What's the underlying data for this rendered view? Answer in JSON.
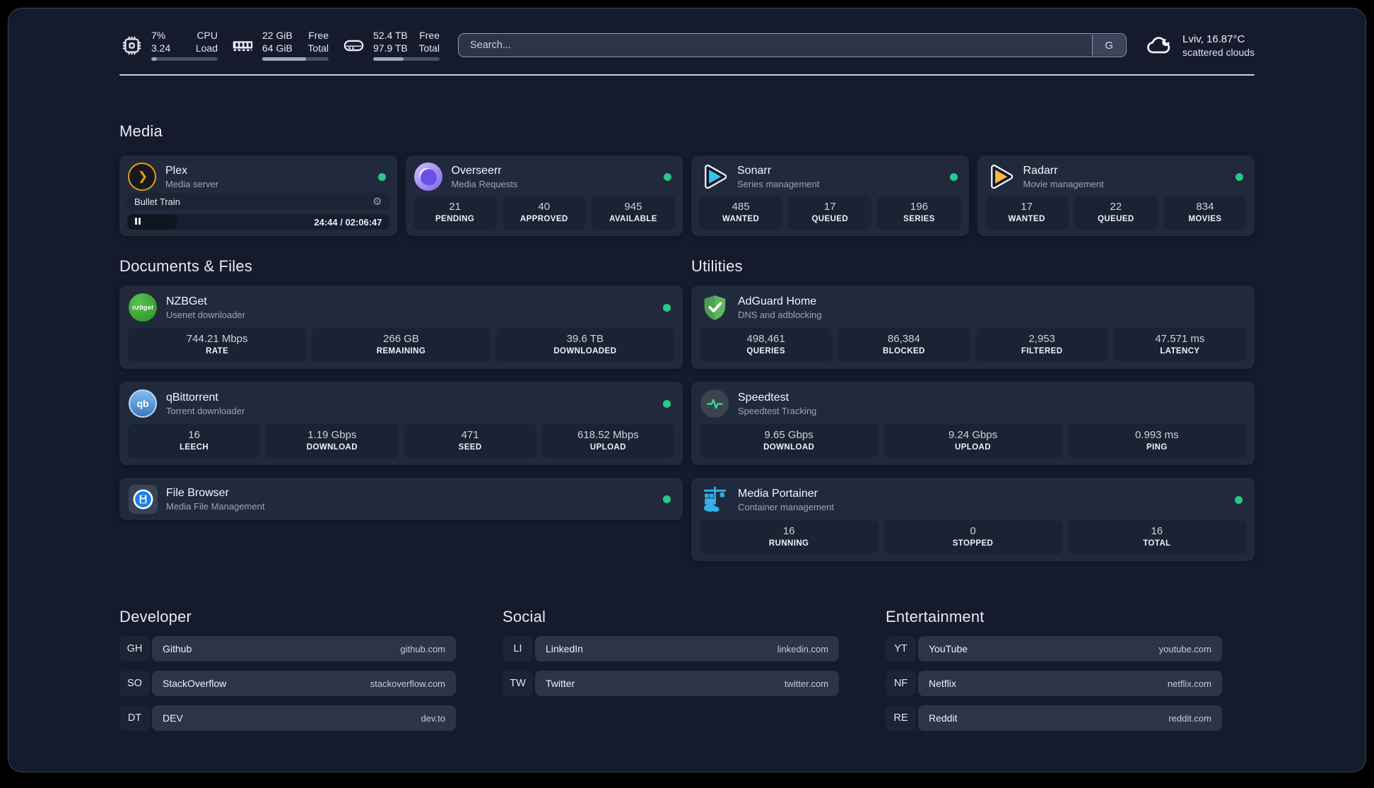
{
  "system_stats": [
    {
      "id": "cpu",
      "icon": "cpu-icon",
      "col1": [
        "7%",
        "3.24"
      ],
      "col2": [
        "CPU",
        "Load"
      ],
      "progress": 8
    },
    {
      "id": "memory",
      "icon": "ram-icon",
      "col1": [
        "22 GiB",
        "64 GiB"
      ],
      "col2": [
        "Free",
        "Total"
      ],
      "progress": 66
    },
    {
      "id": "storage",
      "icon": "disk-icon",
      "col1": [
        "52.4 TB",
        "97.9 TB"
      ],
      "col2": [
        "Free",
        "Total"
      ],
      "progress": 46
    }
  ],
  "search": {
    "placeholder": "Search...",
    "engine": "G"
  },
  "weather": {
    "icon": "cloud-icon",
    "line1": "Lviv, 16.87°C",
    "line2": "scattered clouds"
  },
  "colors": {
    "status_online": "#28c78b",
    "plex_accent": "#e5a00d"
  },
  "sections": [
    {
      "id": "media",
      "title": "Media",
      "cards": [
        {
          "id": "plex",
          "icon": "plex-icon",
          "name": "Plex",
          "subtitle": "Media server",
          "online": true,
          "now_playing": {
            "title": "Bullet Train",
            "time": "24:44 / 02:06:47",
            "progress_pct": 19,
            "state": "paused"
          },
          "stats": []
        },
        {
          "id": "overseerr",
          "icon": "overseerr-icon",
          "name": "Overseerr",
          "subtitle": "Media Requests",
          "online": true,
          "stats": [
            {
              "value": "21",
              "label": "PENDING"
            },
            {
              "value": "40",
              "label": "APPROVED"
            },
            {
              "value": "945",
              "label": "AVAILABLE"
            }
          ]
        },
        {
          "id": "sonarr",
          "icon": "sonarr-icon",
          "name": "Sonarr",
          "subtitle": "Series management",
          "online": true,
          "stats": [
            {
              "value": "485",
              "label": "WANTED"
            },
            {
              "value": "17",
              "label": "QUEUED"
            },
            {
              "value": "196",
              "label": "SERIES"
            }
          ]
        },
        {
          "id": "radarr",
          "icon": "radarr-icon",
          "name": "Radarr",
          "subtitle": "Movie management",
          "online": true,
          "stats": [
            {
              "value": "17",
              "label": "WANTED"
            },
            {
              "value": "22",
              "label": "QUEUED"
            },
            {
              "value": "834",
              "label": "MOVIES"
            }
          ]
        }
      ]
    },
    {
      "id": "documents",
      "title": "Documents & Files",
      "cards": [
        {
          "id": "nzbget",
          "icon": "nzbget-icon",
          "name": "NZBGet",
          "subtitle": "Usenet downloader",
          "online": true,
          "stats": [
            {
              "value": "744.21 Mbps",
              "label": "RATE"
            },
            {
              "value": "266 GB",
              "label": "REMAINING"
            },
            {
              "value": "39.6 TB",
              "label": "DOWNLOADED"
            }
          ]
        },
        {
          "id": "qbittorrent",
          "icon": "qbittorrent-icon",
          "name": "qBittorrent",
          "subtitle": "Torrent downloader",
          "online": true,
          "stats": [
            {
              "value": "16",
              "label": "LEECH"
            },
            {
              "value": "1.19 Gbps",
              "label": "DOWNLOAD"
            },
            {
              "value": "471",
              "label": "SEED"
            },
            {
              "value": "618.52 Mbps",
              "label": "UPLOAD"
            }
          ]
        },
        {
          "id": "filebrowser",
          "icon": "filebrowser-icon",
          "name": "File Browser",
          "subtitle": "Media File Management",
          "online": true,
          "stats": []
        }
      ]
    },
    {
      "id": "utilities",
      "title": "Utilities",
      "cards": [
        {
          "id": "adguard",
          "icon": "adguard-icon",
          "name": "AdGuard Home",
          "subtitle": "DNS and adblocking",
          "online": false,
          "stats": [
            {
              "value": "498,461",
              "label": "QUERIES"
            },
            {
              "value": "86,384",
              "label": "BLOCKED"
            },
            {
              "value": "2,953",
              "label": "FILTERED"
            },
            {
              "value": "47.571 ms",
              "label": "LATENCY"
            }
          ]
        },
        {
          "id": "speedtest",
          "icon": "speedtest-icon",
          "name": "Speedtest",
          "subtitle": "Speedtest Tracking",
          "online": false,
          "stats": [
            {
              "value": "9.65 Gbps",
              "label": "DOWNLOAD"
            },
            {
              "value": "9.24 Gbps",
              "label": "UPLOAD"
            },
            {
              "value": "0.993 ms",
              "label": "PING"
            }
          ]
        },
        {
          "id": "portainer",
          "icon": "portainer-icon",
          "name": "Media Portainer",
          "subtitle": "Container management",
          "online": true,
          "stats": [
            {
              "value": "16",
              "label": "RUNNING"
            },
            {
              "value": "0",
              "label": "STOPPED"
            },
            {
              "value": "16",
              "label": "TOTAL"
            }
          ]
        }
      ]
    }
  ],
  "bookmarks": [
    {
      "title": "Developer",
      "links": [
        {
          "abbr": "GH",
          "name": "Github",
          "url": "github.com"
        },
        {
          "abbr": "SO",
          "name": "StackOverflow",
          "url": "stackoverflow.com"
        },
        {
          "abbr": "DT",
          "name": "DEV",
          "url": "dev.to"
        }
      ]
    },
    {
      "title": "Social",
      "links": [
        {
          "abbr": "LI",
          "name": "LinkedIn",
          "url": "linkedin.com"
        },
        {
          "abbr": "TW",
          "name": "Twitter",
          "url": "twitter.com"
        }
      ]
    },
    {
      "title": "Entertainment",
      "links": [
        {
          "abbr": "YT",
          "name": "YouTube",
          "url": "youtube.com"
        },
        {
          "abbr": "NF",
          "name": "Netflix",
          "url": "netflix.com"
        },
        {
          "abbr": "RE",
          "name": "Reddit",
          "url": "reddit.com"
        }
      ]
    }
  ]
}
